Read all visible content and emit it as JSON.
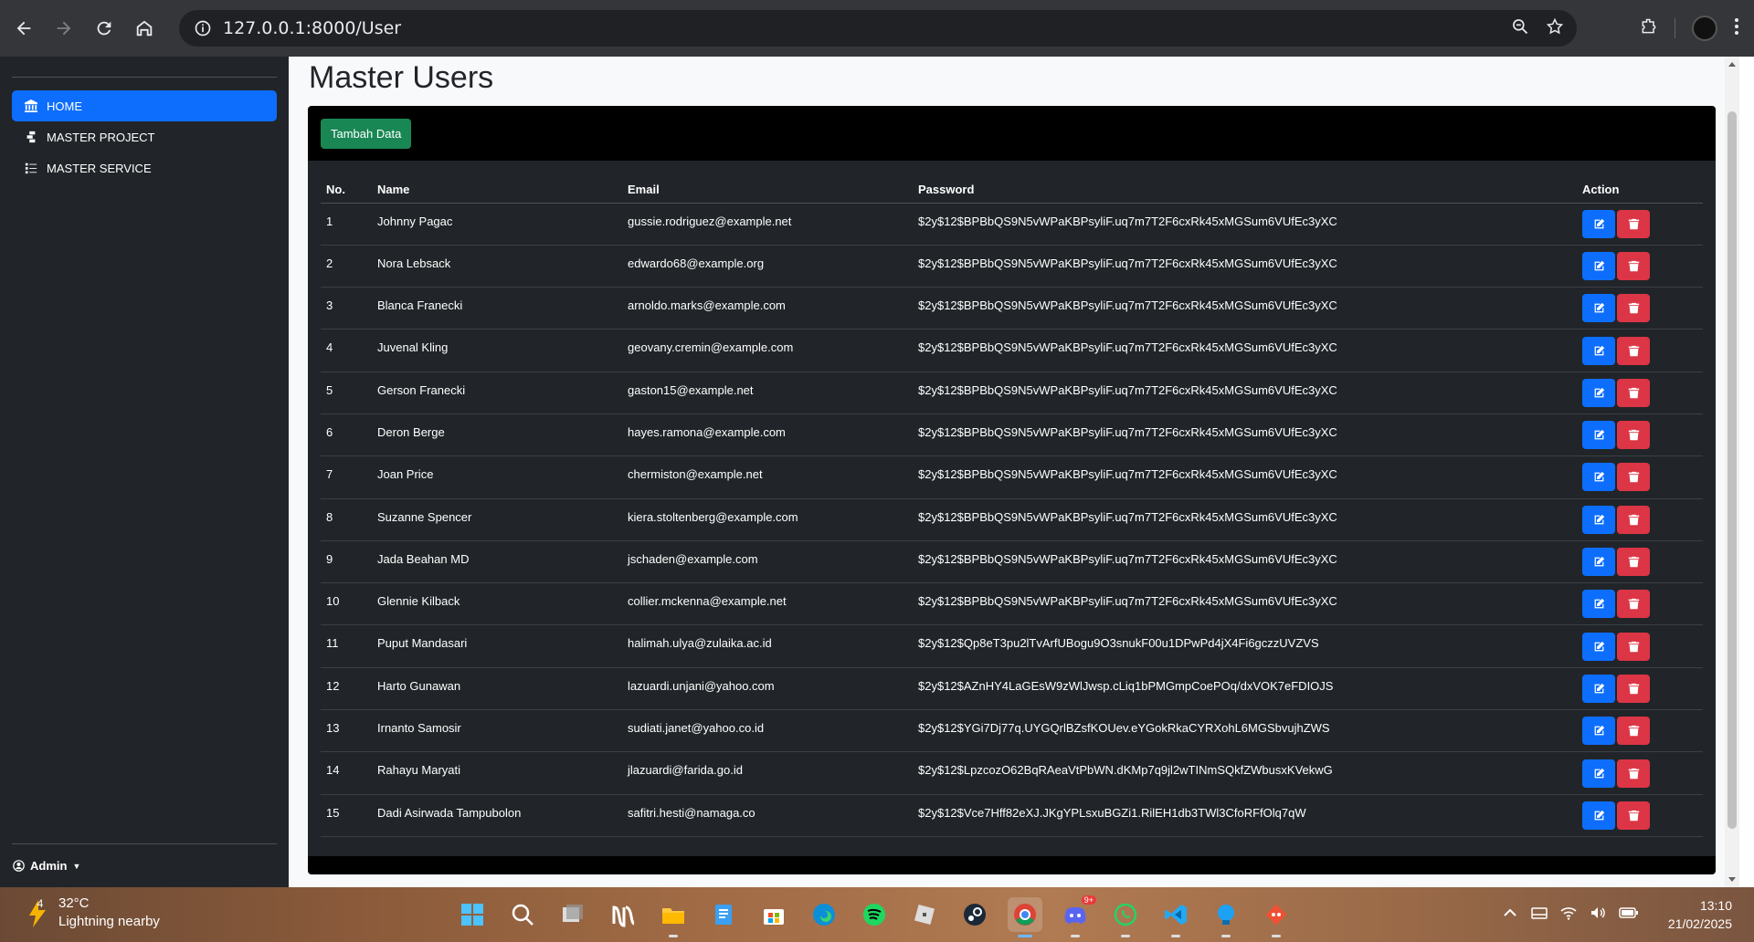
{
  "browser": {
    "url": "127.0.0.1:8000/User"
  },
  "sidebar": {
    "items": [
      {
        "label": "HOME",
        "icon": "bank-icon",
        "active": true
      },
      {
        "label": "MASTER PROJECT",
        "icon": "project-icon",
        "active": false
      },
      {
        "label": "MASTER SERVICE",
        "icon": "list-icon",
        "active": false
      }
    ],
    "user": "Admin"
  },
  "main": {
    "title": "Master Users",
    "add_button": "Tambah Data",
    "columns": [
      "No.",
      "Name",
      "Email",
      "Password",
      "Action"
    ],
    "rows": [
      {
        "no": "1",
        "name": "Johnny Pagac",
        "email": "gussie.rodriguez@example.net",
        "password": "$2y$12$BPBbQS9N5vWPaKBPsyliF.uq7m7T2F6cxRk45xMGSum6VUfEc3yXC"
      },
      {
        "no": "2",
        "name": "Nora Lebsack",
        "email": "edwardo68@example.org",
        "password": "$2y$12$BPBbQS9N5vWPaKBPsyliF.uq7m7T2F6cxRk45xMGSum6VUfEc3yXC"
      },
      {
        "no": "3",
        "name": "Blanca Franecki",
        "email": "arnoldo.marks@example.com",
        "password": "$2y$12$BPBbQS9N5vWPaKBPsyliF.uq7m7T2F6cxRk45xMGSum6VUfEc3yXC"
      },
      {
        "no": "4",
        "name": "Juvenal Kling",
        "email": "geovany.cremin@example.com",
        "password": "$2y$12$BPBbQS9N5vWPaKBPsyliF.uq7m7T2F6cxRk45xMGSum6VUfEc3yXC"
      },
      {
        "no": "5",
        "name": "Gerson Franecki",
        "email": "gaston15@example.net",
        "password": "$2y$12$BPBbQS9N5vWPaKBPsyliF.uq7m7T2F6cxRk45xMGSum6VUfEc3yXC"
      },
      {
        "no": "6",
        "name": "Deron Berge",
        "email": "hayes.ramona@example.com",
        "password": "$2y$12$BPBbQS9N5vWPaKBPsyliF.uq7m7T2F6cxRk45xMGSum6VUfEc3yXC"
      },
      {
        "no": "7",
        "name": "Joan Price",
        "email": "chermiston@example.net",
        "password": "$2y$12$BPBbQS9N5vWPaKBPsyliF.uq7m7T2F6cxRk45xMGSum6VUfEc3yXC"
      },
      {
        "no": "8",
        "name": "Suzanne Spencer",
        "email": "kiera.stoltenberg@example.com",
        "password": "$2y$12$BPBbQS9N5vWPaKBPsyliF.uq7m7T2F6cxRk45xMGSum6VUfEc3yXC"
      },
      {
        "no": "9",
        "name": "Jada Beahan MD",
        "email": "jschaden@example.com",
        "password": "$2y$12$BPBbQS9N5vWPaKBPsyliF.uq7m7T2F6cxRk45xMGSum6VUfEc3yXC"
      },
      {
        "no": "10",
        "name": "Glennie Kilback",
        "email": "collier.mckenna@example.net",
        "password": "$2y$12$BPBbQS9N5vWPaKBPsyliF.uq7m7T2F6cxRk45xMGSum6VUfEc3yXC"
      },
      {
        "no": "11",
        "name": "Puput Mandasari",
        "email": "halimah.ulya@zulaika.ac.id",
        "password": "$2y$12$Qp8eT3pu2lTvArfUBogu9O3snukF00u1DPwPd4jX4Fi6gczzUVZVS"
      },
      {
        "no": "12",
        "name": "Harto Gunawan",
        "email": "lazuardi.unjani@yahoo.com",
        "password": "$2y$12$AZnHY4LaGEsW9zWlJwsp.cLiq1bPMGmpCoePOq/dxVOK7eFDIOJS"
      },
      {
        "no": "13",
        "name": "Irnanto Samosir",
        "email": "sudiati.janet@yahoo.co.id",
        "password": "$2y$12$YGi7Dj77q.UYGQrlBZsfKOUev.eYGokRkaCYRXohL6MGSbvujhZWS"
      },
      {
        "no": "14",
        "name": "Rahayu Maryati",
        "email": "jlazuardi@farida.go.id",
        "password": "$2y$12$LpzcozO62BqRAeaVtPbWN.dKMp7q9jl2wTINmSQkfZWbusxKVekwG"
      },
      {
        "no": "15",
        "name": "Dadi Asirwada Tampubolon",
        "email": "safitri.hesti@namaga.co",
        "password": "$2y$12$Vce7Hff82eXJ.JKgYPLsxuBGZi1.RilEH1db3TWl3CfoRFfOlq7qW"
      }
    ]
  },
  "taskbar": {
    "weather_badge": "4",
    "temperature": "32°C",
    "weather_desc": "Lightning nearby",
    "time": "13:10",
    "date": "21/02/2025",
    "discord_badge": "9+"
  },
  "colors": {
    "primary": "#0d6efd",
    "success": "#198754",
    "danger": "#dc3545",
    "sidebar_bg": "#212529"
  }
}
